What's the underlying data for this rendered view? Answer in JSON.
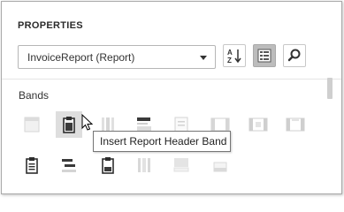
{
  "panel": {
    "title": "PROPERTIES",
    "selected_component": "InvoiceReport (Report)"
  },
  "toolbar": {
    "sort_icon": "sort-alphabetical-icon",
    "categories_icon": "categories-icon",
    "search_icon": "search-icon",
    "categories_active": true
  },
  "bands": {
    "label": "Bands",
    "tooltip": "Insert Report Header Band",
    "row1": [
      "top-margin-band-icon",
      "report-header-band-icon",
      "page-header-band-icon",
      "group-header-band-icon",
      "detail-band-icon",
      "detail-report-band-icon",
      "group-footer-band-icon",
      "report-footer-band-icon"
    ],
    "row2": [
      "report-footer-band-icon",
      "group-footer-band-icon",
      "page-footer-band-icon",
      "vertical-header-band-icon",
      "vertical-detail-band-icon",
      "bottom-margin-band-icon"
    ]
  },
  "colors": {
    "accent_selected": "#bcbcbc",
    "icon_dark": "#3a3a3a",
    "icon_light": "#d0d0d0"
  }
}
